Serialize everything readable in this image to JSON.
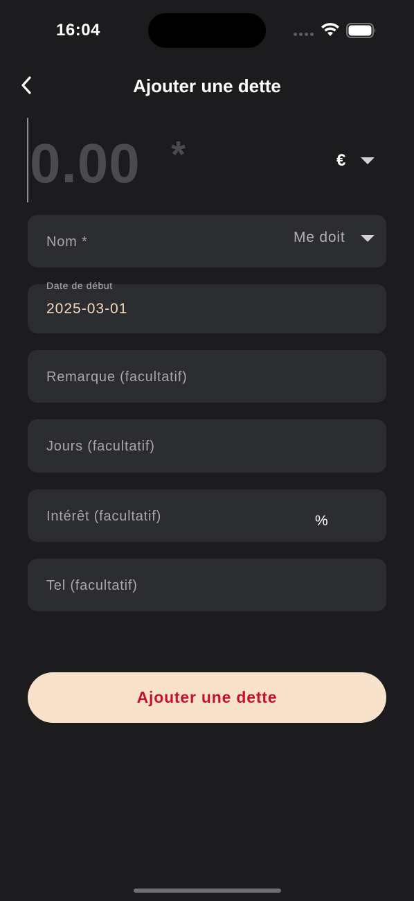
{
  "status_bar": {
    "time": "16:04"
  },
  "nav": {
    "title": "Ajouter une dette",
    "back_icon": "chevron-left-icon"
  },
  "amount": {
    "value": "0.00",
    "required_mark": "*",
    "currency": "€"
  },
  "form": {
    "nom": {
      "placeholder": "Nom *",
      "direction": "Me doit"
    },
    "date": {
      "label": "Date de début",
      "value": "2025-03-01"
    },
    "remarque": {
      "placeholder": "Remarque (facultatif)"
    },
    "jours": {
      "placeholder": "Jours (facultatif)"
    },
    "interet": {
      "placeholder": "Intérêt (facultatif)",
      "unit": "%"
    },
    "tel": {
      "placeholder": "Tel (facultatif)"
    }
  },
  "submit": {
    "label": "Ajouter une dette"
  },
  "colors": {
    "background": "#1c1c1e",
    "field": "#2c2d30",
    "button_bg": "#f8e2cb",
    "button_text": "#c8102e",
    "date_text": "#f3d9c0"
  }
}
